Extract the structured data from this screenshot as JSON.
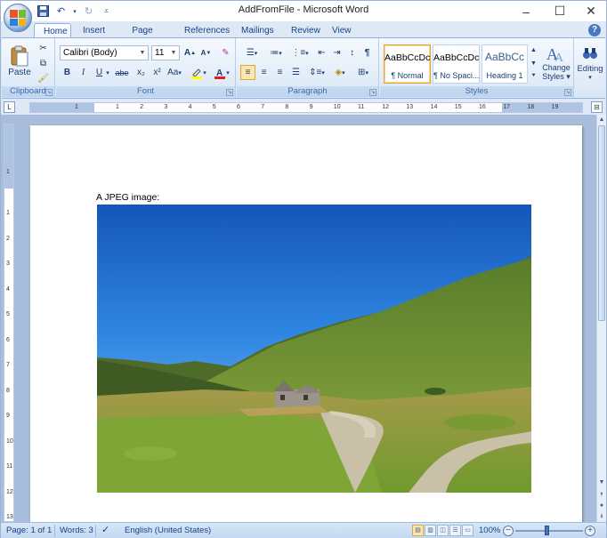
{
  "window": {
    "title": "AddFromFile - Microsoft Word",
    "minimize_glyph": "–",
    "maximize_glyph": "☐",
    "close_glyph": "✕"
  },
  "quick_access": {
    "save_icon": "save-icon",
    "undo_icon": "undo-icon",
    "redo_icon": "redo-icon",
    "customize_icon": "customize-icon"
  },
  "tabs": [
    "Home",
    "Insert",
    "Page Layout",
    "References",
    "Mailings",
    "Review",
    "View"
  ],
  "active_tab": "Home",
  "ribbon": {
    "clipboard": {
      "label": "Clipboard",
      "paste_label": "Paste"
    },
    "font": {
      "label": "Font",
      "font_name": "Calibri (Body)",
      "font_size": "11",
      "bold": "B",
      "italic": "I",
      "underline": "U",
      "strikethrough": "abe",
      "subscript": "x₂",
      "superscript": "x²",
      "change_case": "Aa",
      "grow": "A",
      "shrink": "A"
    },
    "paragraph": {
      "label": "Paragraph"
    },
    "styles": {
      "label": "Styles",
      "items": [
        {
          "sample": "AaBbCcDc",
          "name": "¶ Normal",
          "selected": true
        },
        {
          "sample": "AaBbCcDc",
          "name": "¶ No Spaci...",
          "selected": false
        },
        {
          "sample": "AaBbCc",
          "name": "Heading 1",
          "selected": false
        }
      ],
      "change_styles_line1": "Change",
      "change_styles_line2": "Styles ▾"
    },
    "editing": {
      "label": "Editing"
    }
  },
  "ruler": {
    "h_numbers": [
      "1",
      "1",
      "2",
      "3",
      "4",
      "5",
      "6",
      "7",
      "8",
      "9",
      "10",
      "11",
      "12",
      "13",
      "14",
      "15",
      "16",
      "17",
      "18",
      "19"
    ],
    "v_numbers": [
      "1",
      "1",
      "2",
      "3",
      "4",
      "5",
      "6",
      "7",
      "8",
      "9",
      "10",
      "11",
      "12",
      "13"
    ]
  },
  "document": {
    "text": "A JPEG image:"
  },
  "status": {
    "page": "Page: 1 of 1",
    "words": "Words: 3",
    "language": "English (United States)",
    "zoom": "100%"
  },
  "colors": {
    "ribbon_bg": "#dfe9f5",
    "accent": "#15428b",
    "doc_bg": "#a9bedc"
  }
}
